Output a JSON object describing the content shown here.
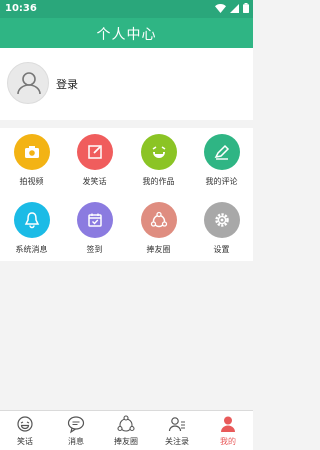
{
  "status": {
    "time": "10:36"
  },
  "header": {
    "title": "个人中心"
  },
  "profile": {
    "login_label": "登录"
  },
  "menu": [
    {
      "label": "拍视频",
      "icon": "camera-icon",
      "color": "#f3b314"
    },
    {
      "label": "发笑话",
      "icon": "compose-icon",
      "color": "#f05d5d"
    },
    {
      "label": "我的作品",
      "icon": "laugh-icon",
      "color": "#8bc425"
    },
    {
      "label": "我的评论",
      "icon": "pencil-icon",
      "color": "#2fb584"
    },
    {
      "label": "系统消息",
      "icon": "bell-icon",
      "color": "#1bbbe6"
    },
    {
      "label": "签到",
      "icon": "calendar-icon",
      "color": "#8b7be0"
    },
    {
      "label": "捧友圈",
      "icon": "share-circle-icon",
      "color": "#df8d80"
    },
    {
      "label": "设置",
      "icon": "gear-icon",
      "color": "#a8a8a8"
    }
  ],
  "tabs": [
    {
      "label": "笑话",
      "icon": "joke-face-icon"
    },
    {
      "label": "消息",
      "icon": "chat-bubble-icon"
    },
    {
      "label": "捧友圈",
      "icon": "friends-circle-icon"
    },
    {
      "label": "关注录",
      "icon": "follow-list-icon"
    },
    {
      "label": "我的",
      "icon": "person-icon",
      "active": true
    }
  ],
  "colors": {
    "brand": "#2fb584",
    "active_tab": "#e85a5a"
  }
}
